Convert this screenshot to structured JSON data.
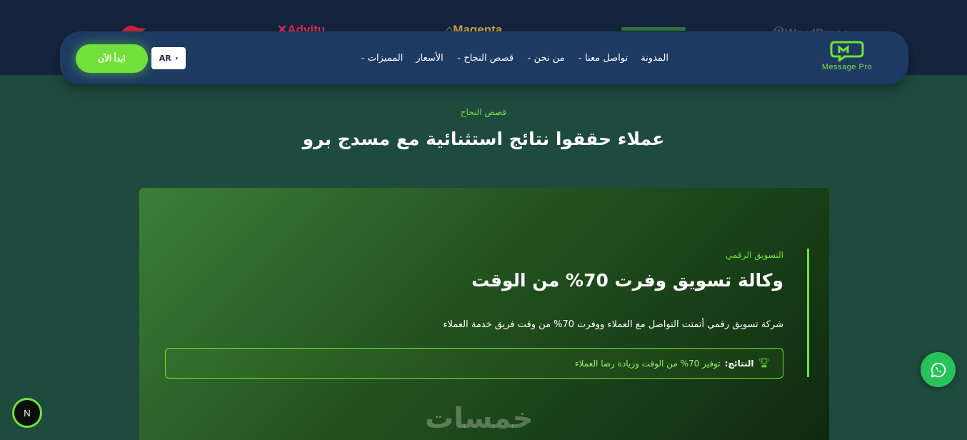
{
  "logo_strip": [
    {
      "icon": "rocket-logo-icon",
      "text": "",
      "color": "#d0243c"
    },
    {
      "icon": "adviz-logo-icon",
      "text": "Advitu",
      "color": "#e42c54"
    },
    {
      "icon": "house-logo-icon",
      "text": "Magenta",
      "color": "#c9a447"
    },
    {
      "icon": "leaf-logo-icon",
      "text": "",
      "color": "#2e7a38"
    },
    {
      "icon": "wp-logo-icon",
      "text": "WordPress",
      "color": "#4a5a74"
    }
  ],
  "nav": {
    "brand_name": "Message Pro",
    "links": [
      {
        "label": "المميزات",
        "dropdown": true
      },
      {
        "label": "الأسعار",
        "dropdown": false
      },
      {
        "label": "قصص النجاح",
        "dropdown": true
      },
      {
        "label": "من نحن",
        "dropdown": true
      },
      {
        "label": "تواصل معنا",
        "dropdown": true
      },
      {
        "label": "المدونة",
        "dropdown": false
      }
    ],
    "lang_label": "AR",
    "cta_label": "ابدأ الآن"
  },
  "section": {
    "eyebrow": "قصص النجاح",
    "title": "عملاء حققوا نتائج استثنائية مع مسدج برو"
  },
  "card": {
    "category": "التسويق الرقمي",
    "title": "وكالة تسويق وفرت 70% من الوقت",
    "description": "شركة تسويق رقمي أتمتت التواصل مع العملاء ووفرت 70% من وقت فريق خدمة العملاء",
    "result_label": "النتائج:",
    "result_text": "توفير 70% من الوقت وزيادة رضا العملاء"
  },
  "watermark": "خمسات",
  "floating": {
    "badge_letter": "N"
  },
  "colors": {
    "accent": "#72e03a",
    "navbar": "#1d3b62",
    "page_bg": "#1f4a3e",
    "whatsapp": "#29c25a"
  }
}
